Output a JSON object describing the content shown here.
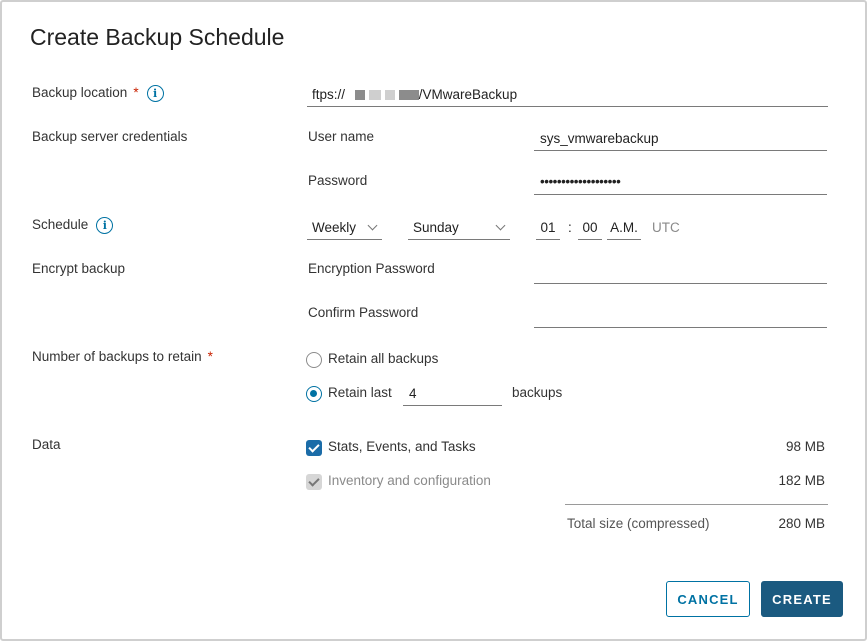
{
  "dialog": {
    "title": "Create Backup Schedule"
  },
  "backup_location": {
    "label": "Backup location",
    "required_mark": "*",
    "info_glyph": "i",
    "prefix": "ftps://",
    "suffix": "/VMwareBackup"
  },
  "credentials": {
    "label": "Backup server credentials",
    "username_label": "User name",
    "username_value": "sys_vmwarebackup",
    "password_label": "Password",
    "password_value": "•••••••••••••••••••"
  },
  "schedule": {
    "label": "Schedule",
    "info_glyph": "i",
    "frequency": "Weekly",
    "day": "Sunday",
    "hour": "01",
    "separator": ":",
    "minute": "00",
    "ampm": "A.M.",
    "timezone": "UTC"
  },
  "encrypt": {
    "label": "Encrypt backup",
    "password_label": "Encryption Password",
    "confirm_label": "Confirm Password"
  },
  "retain": {
    "label": "Number of backups to retain",
    "required_mark": "*",
    "option_all": "Retain all backups",
    "option_last": "Retain last",
    "last_value": "4",
    "suffix": "backups",
    "selected": "last"
  },
  "data": {
    "label": "Data",
    "items": [
      {
        "label": "Stats, Events, and Tasks",
        "size": "98 MB",
        "checked": true,
        "disabled": false
      },
      {
        "label": "Inventory and configuration",
        "size": "182 MB",
        "checked": true,
        "disabled": true
      }
    ],
    "total_label": "Total size (compressed)",
    "total_size": "280 MB"
  },
  "buttons": {
    "cancel": "CANCEL",
    "create": "CREATE"
  },
  "colors": {
    "accent": "#0072a3",
    "primary_button": "#1b5a80",
    "required": "#c92100"
  }
}
